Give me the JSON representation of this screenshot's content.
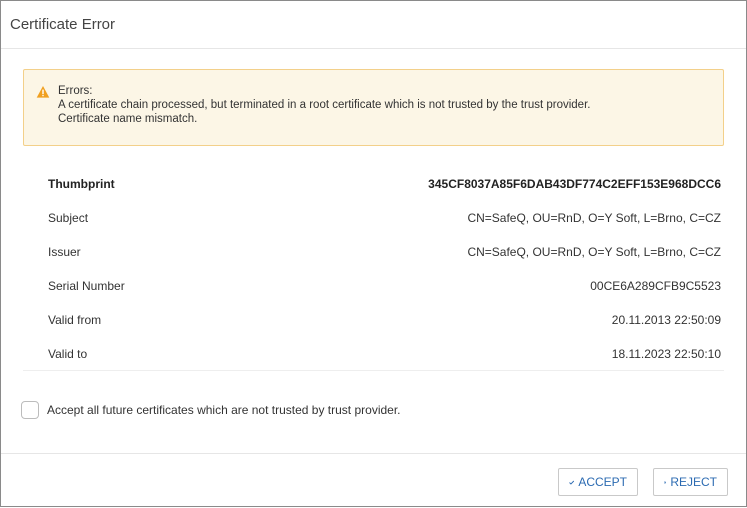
{
  "dialog": {
    "title": "Certificate Error"
  },
  "alert": {
    "heading": "Errors:",
    "messages": [
      "A certificate chain processed, but terminated in a root certificate which is not trusted by the trust provider.",
      "Certificate name mismatch."
    ],
    "icon": "warning-icon",
    "color": "#f0a020"
  },
  "details": [
    {
      "label": "Thumbprint",
      "value": "345CF8037A85F6DAB43DF774C2EFF153E968DCC6"
    },
    {
      "label": "Subject",
      "value": "CN=SafeQ, OU=RnD, O=Y Soft, L=Brno, C=CZ"
    },
    {
      "label": "Issuer",
      "value": "CN=SafeQ, OU=RnD, O=Y Soft, L=Brno, C=CZ"
    },
    {
      "label": "Serial Number",
      "value": "00CE6A289CFB9C5523"
    },
    {
      "label": "Valid from",
      "value": "20.11.2013 22:50:09"
    },
    {
      "label": "Valid to",
      "value": "18.11.2023 22:50:10"
    }
  ],
  "accept_all": {
    "label": "Accept all future certificates which are not trusted by trust provider.",
    "checked": false
  },
  "buttons": {
    "accept": "ACCEPT",
    "reject": "REJECT",
    "accent": "#2c6bb2"
  }
}
